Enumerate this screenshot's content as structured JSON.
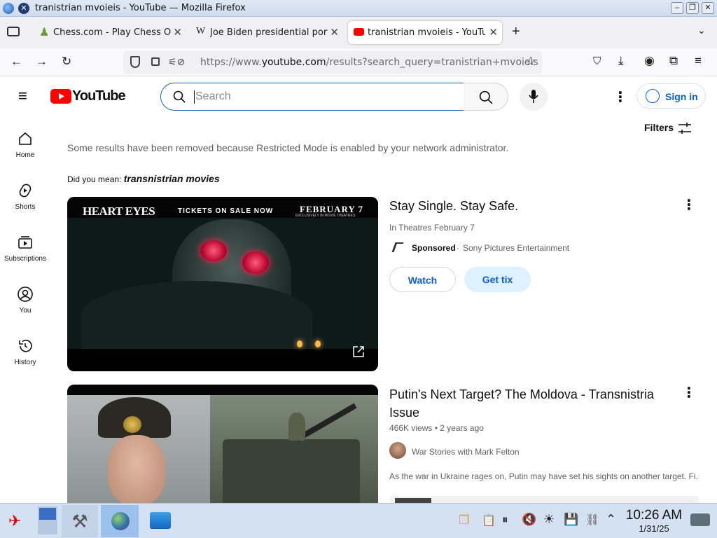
{
  "window": {
    "title": "tranistrian mvoieis - YouTube — Mozilla Firefox"
  },
  "tabs": [
    {
      "label": "Chess.com - Play Chess On"
    },
    {
      "label": "Joe Biden presidential port"
    },
    {
      "label": "tranistrian mvoieis - YouTu"
    }
  ],
  "nav": {
    "url_prefix": "https://www.",
    "url_domain": "youtube.com",
    "url_rest": "/results?search_query=tranistrian+mvoieis"
  },
  "yt": {
    "logo": "YouTube",
    "search_placeholder": "Search",
    "sign_in": "Sign in",
    "filters": "Filters",
    "restricted_notice": "Some results have been removed because Restricted Mode is enabled by your network administrator.",
    "did_you_mean_label": "Did you mean: ",
    "did_you_mean_term": "transnistrian movies"
  },
  "sidebar": [
    {
      "label": "Home",
      "icon": "home-icon"
    },
    {
      "label": "Shorts",
      "icon": "shorts-icon"
    },
    {
      "label": "Subscriptions",
      "icon": "subscriptions-icon"
    },
    {
      "label": "You",
      "icon": "you-icon"
    },
    {
      "label": "History",
      "icon": "history-icon"
    }
  ],
  "ad": {
    "title": "Stay Single. Stay Safe.",
    "subtitle": "In Theatres February 7",
    "sponsored": "Sponsored",
    "advertiser": "Sony Pictures Entertainment",
    "watch": "Watch",
    "get_tix": "Get tix",
    "thumb_text_left": "HEART EYES",
    "thumb_text_mid": "TICKETS ON SALE NOW",
    "thumb_text_right": "FEBRUARY 7",
    "thumb_text_right_sub": "EXCLUSIVELY IN MOVIE THEATRES"
  },
  "video": {
    "title": "Putin's Next Target? The Moldova - Transnistria Issue",
    "views": "466K views",
    "age": "2 years ago",
    "channel": "War Stories with Mark Felton",
    "description": "As the war in Ukraine rages on, Putin may have set his sights on another target. Fi..."
  },
  "taskbar": {
    "time": "10:26 AM",
    "date": "1/31/25"
  }
}
